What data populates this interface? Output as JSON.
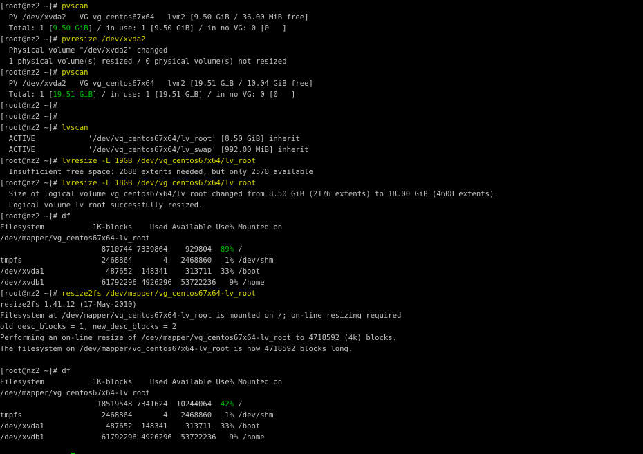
{
  "terminal": {
    "lines": [
      {
        "segments": [
          {
            "t": "[root@nz2 ~]# "
          },
          {
            "t": "pvscan",
            "c": "cmd"
          }
        ]
      },
      {
        "segments": [
          {
            "t": "  PV /dev/xvda2   VG vg_centos67x64   lvm2 [9.50 GiB / 36.00 MiB free]"
          }
        ]
      },
      {
        "segments": [
          {
            "t": "  Total: 1 ["
          },
          {
            "t": "9.50 GiB",
            "c": "grn"
          },
          {
            "t": "] / in use: 1 [9.50 GiB] / in no VG: 0 [0   ]"
          }
        ]
      },
      {
        "segments": [
          {
            "t": "[root@nz2 ~]# "
          },
          {
            "t": "pvresize /dev/xvda2",
            "c": "cmd"
          }
        ]
      },
      {
        "segments": [
          {
            "t": "  Physical volume \"/dev/xvda2\" changed"
          }
        ]
      },
      {
        "segments": [
          {
            "t": "  1 physical volume(s) resized / 0 physical volume(s) not resized"
          }
        ]
      },
      {
        "segments": [
          {
            "t": "[root@nz2 ~]# "
          },
          {
            "t": "pvscan",
            "c": "cmd"
          }
        ]
      },
      {
        "segments": [
          {
            "t": "  PV /dev/xvda2   VG vg_centos67x64   lvm2 [19.51 GiB / 10.04 GiB free]"
          }
        ]
      },
      {
        "segments": [
          {
            "t": "  Total: 1 ["
          },
          {
            "t": "19.51 GiB",
            "c": "grn"
          },
          {
            "t": "] / in use: 1 [19.51 GiB] / in no VG: 0 [0   ]"
          }
        ]
      },
      {
        "segments": [
          {
            "t": "[root@nz2 ~]#"
          }
        ]
      },
      {
        "segments": [
          {
            "t": "[root@nz2 ~]#"
          }
        ]
      },
      {
        "segments": [
          {
            "t": "[root@nz2 ~]# "
          },
          {
            "t": "lvscan",
            "c": "cmd"
          }
        ]
      },
      {
        "segments": [
          {
            "t": "  ACTIVE            '/dev/vg_centos67x64/lv_root' [8.50 GiB] inherit"
          }
        ]
      },
      {
        "segments": [
          {
            "t": "  ACTIVE            '/dev/vg_centos67x64/lv_swap' [992.00 MiB] inherit"
          }
        ]
      },
      {
        "segments": [
          {
            "t": "[root@nz2 ~]# "
          },
          {
            "t": "lvresize -L 19GB /dev/vg_centos67x64/lv_root",
            "c": "cmd"
          }
        ]
      },
      {
        "segments": [
          {
            "t": "  Insufficient free space: 2688 extents needed, but only 2570 available"
          }
        ]
      },
      {
        "segments": [
          {
            "t": "[root@nz2 ~]# "
          },
          {
            "t": "lvresize -L 18GB /dev/vg_centos67x64/lv_root",
            "c": "cmd"
          }
        ]
      },
      {
        "segments": [
          {
            "t": "  Size of logical volume vg_centos67x64/lv_root changed from 8.50 GiB (2176 extents) to 18.00 GiB (4608 extents)."
          }
        ]
      },
      {
        "segments": [
          {
            "t": "  Logical volume lv_root successfully resized."
          }
        ]
      },
      {
        "segments": [
          {
            "t": "[root@nz2 ~]# df"
          }
        ]
      },
      {
        "segments": [
          {
            "t": "Filesystem           1K-blocks    Used Available Use% Mounted on"
          }
        ]
      },
      {
        "segments": [
          {
            "t": "/dev/mapper/vg_centos67x64-lv_root"
          }
        ]
      },
      {
        "segments": [
          {
            "t": "                       8710744 7339864    929804  "
          },
          {
            "t": "89%",
            "c": "grn"
          },
          {
            "t": " /"
          }
        ]
      },
      {
        "segments": [
          {
            "t": "tmpfs                  2468864       4   2468860   1% /dev/shm"
          }
        ]
      },
      {
        "segments": [
          {
            "t": "/dev/xvda1              487652  148341    313711  33% /boot"
          }
        ]
      },
      {
        "segments": [
          {
            "t": "/dev/xvdb1             61792296 4926296  53722236   9% /home"
          }
        ]
      },
      {
        "segments": [
          {
            "t": "[root@nz2 ~]# "
          },
          {
            "t": "resize2fs /dev/mapper/vg_centos67x64-lv_root",
            "c": "cmd"
          }
        ]
      },
      {
        "segments": [
          {
            "t": "resize2fs 1.41.12 (17-May-2010)"
          }
        ]
      },
      {
        "segments": [
          {
            "t": "Filesystem at /dev/mapper/vg_centos67x64-lv_root is mounted on /; on-line resizing required"
          }
        ]
      },
      {
        "segments": [
          {
            "t": "old desc_blocks = 1, new_desc_blocks = 2"
          }
        ]
      },
      {
        "segments": [
          {
            "t": "Performing an on-line resize of /dev/mapper/vg_centos67x64-lv_root to 4718592 (4k) blocks."
          }
        ]
      },
      {
        "segments": [
          {
            "t": "The filesystem on /dev/mapper/vg_centos67x64-lv_root is now 4718592 blocks long."
          }
        ]
      },
      {
        "segments": [
          {
            "t": ""
          }
        ]
      },
      {
        "segments": [
          {
            "t": "[root@nz2 ~]# df"
          }
        ]
      },
      {
        "segments": [
          {
            "t": "Filesystem           1K-blocks    Used Available Use% Mounted on"
          }
        ]
      },
      {
        "segments": [
          {
            "t": "/dev/mapper/vg_centos67x64-lv_root"
          }
        ]
      },
      {
        "segments": [
          {
            "t": "                      18519548 7341624  10244064  "
          },
          {
            "t": "42%",
            "c": "grn"
          },
          {
            "t": " /"
          }
        ]
      },
      {
        "segments": [
          {
            "t": "tmpfs                  2468864       4   2468860   1% /dev/shm"
          }
        ]
      },
      {
        "segments": [
          {
            "t": "/dev/xvda1              487652  148341    313711  33% /boot"
          }
        ]
      },
      {
        "segments": [
          {
            "t": "/dev/xvdb1             61792296 4926296  53722236   9% /home"
          }
        ]
      }
    ],
    "colors": {
      "background": "#000000",
      "text": "#c0c0c0",
      "command": "#d4d400",
      "highlight": "#00c000"
    }
  }
}
